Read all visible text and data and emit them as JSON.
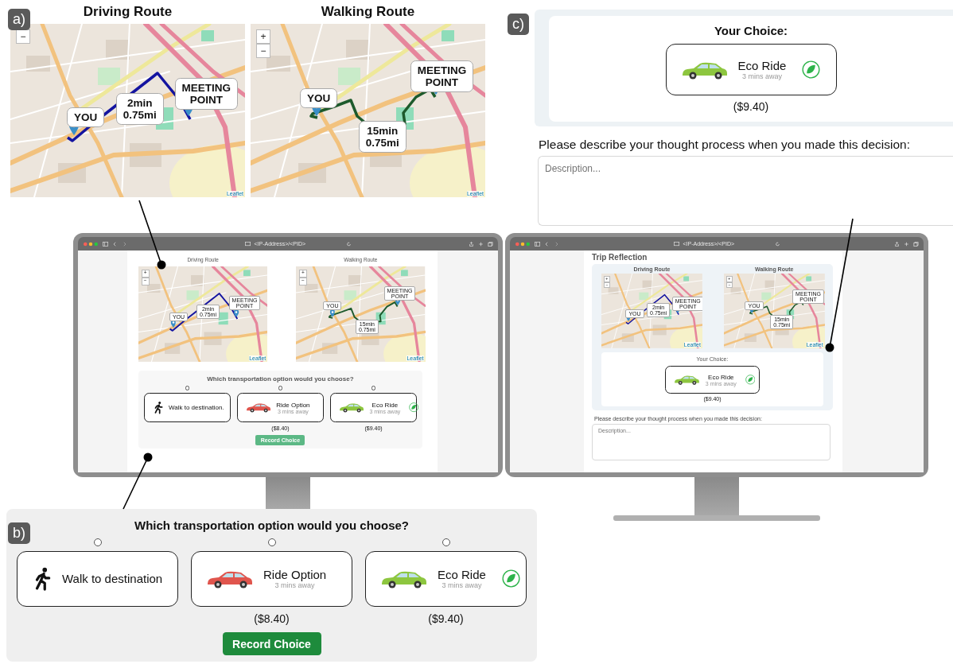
{
  "panel_a": {
    "label": "a)",
    "maps": [
      {
        "kind": "driving",
        "title": "Driving Route",
        "origin": "YOU",
        "destination": "MEETING POINT",
        "route_info": [
          "2min",
          "0.75mi"
        ],
        "zoom_controls": [
          "−"
        ],
        "attribution": "Leaflet"
      },
      {
        "kind": "walking",
        "title": "Walking Route",
        "origin": "YOU",
        "destination": "MEETING POINT",
        "route_info": [
          "15min",
          "0.75mi"
        ],
        "zoom_controls": [
          "+",
          "−"
        ],
        "attribution": "Leaflet"
      }
    ]
  },
  "panel_c": {
    "label": "c)",
    "your_choice": {
      "title": "Your Choice:",
      "option": {
        "kind": "eco",
        "name": "Eco Ride",
        "subtitle": "3 mins away"
      },
      "price": "($9.40)"
    },
    "prompt": "Please describe your thought process when you made this decision:",
    "placeholder": "Description..."
  },
  "monitors": [
    {
      "kind": "choice",
      "url": "<IP-Address>/<PID>",
      "maps": [
        {
          "kind": "driving",
          "title": "Driving Route",
          "origin": "YOU",
          "destination": "MEETING POINT",
          "route_info": [
            "2min",
            "0.75mi"
          ],
          "zoom_controls": [
            "+",
            "−"
          ],
          "attribution": "Leaflet"
        },
        {
          "kind": "walking",
          "title": "Walking Route",
          "origin": "YOU",
          "destination": "MEETING POINT",
          "route_info": [
            "15min",
            "0.75mi"
          ],
          "zoom_controls": [
            "+",
            "−"
          ],
          "attribution": "Leaflet"
        }
      ],
      "choice": {
        "question": "Which transportation option would you choose?",
        "options": [
          {
            "kind": "walk",
            "name": "Walk to destination.",
            "selected": false
          },
          {
            "kind": "car",
            "name": "Ride Option",
            "subtitle": "3 mins away",
            "price": "($8.40)",
            "selected": false
          },
          {
            "kind": "eco",
            "name": "Eco Ride",
            "subtitle": "3 mins away",
            "price": "($9.40)",
            "selected": false
          }
        ],
        "button": "Record Choice"
      }
    },
    {
      "kind": "reflection",
      "url": "<IP-Address>/<PID>",
      "heading": "Trip Reflection",
      "maps": [
        {
          "kind": "driving",
          "title": "Driving Route",
          "origin": "YOU",
          "destination": "MEETING POINT",
          "route_info": [
            "2min",
            "0.75mi"
          ],
          "zoom_controls": [
            "+",
            "−"
          ],
          "attribution": "Leaflet"
        },
        {
          "kind": "walking",
          "title": "Walking Route",
          "origin": "YOU",
          "destination": "MEETING POINT",
          "route_info": [
            "15min",
            "0.75mi"
          ],
          "zoom_controls": [
            "+",
            "−"
          ],
          "attribution": "Leaflet"
        }
      ],
      "your_choice": {
        "title": "Your Choice:",
        "option": {
          "kind": "eco",
          "name": "Eco Ride",
          "subtitle": "3 mins away"
        },
        "price": "($9.40)"
      },
      "prompt": "Please describe your thought process when you made this decision:",
      "placeholder": "Description..."
    }
  ],
  "panel_b": {
    "label": "b)",
    "question": "Which transportation option would you choose?",
    "options": [
      {
        "kind": "walk",
        "name": "Walk to destination",
        "selected": false
      },
      {
        "kind": "car",
        "name": "Ride Option",
        "subtitle": "3 mins away",
        "price": "($8.40)",
        "selected": false
      },
      {
        "kind": "eco",
        "name": "Eco Ride",
        "subtitle": "3 mins away",
        "price": "($9.40)",
        "selected": false
      }
    ],
    "button": "Record Choice"
  }
}
